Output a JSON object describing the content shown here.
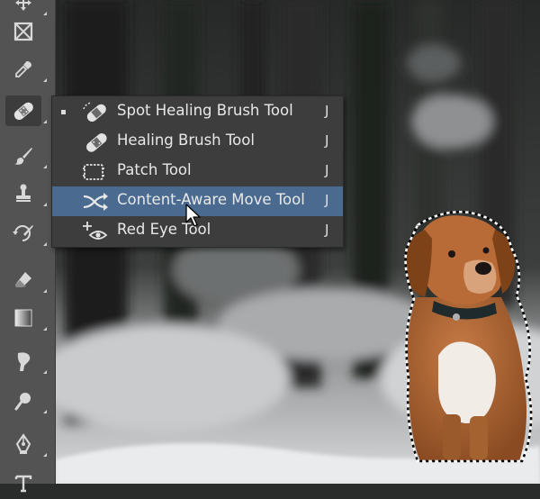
{
  "flyout": {
    "items": [
      {
        "label": "Spot Healing Brush Tool",
        "key": "J",
        "icon": "spot-healing-brush-icon"
      },
      {
        "label": "Healing Brush Tool",
        "key": "J",
        "icon": "healing-brush-icon"
      },
      {
        "label": "Patch Tool",
        "key": "J",
        "icon": "patch-icon"
      },
      {
        "label": "Content-Aware Move Tool",
        "key": "J",
        "icon": "content-aware-move-icon"
      },
      {
        "label": "Red Eye Tool",
        "key": "J",
        "icon": "red-eye-icon"
      }
    ],
    "selected_index": 0,
    "highlighted_index": 3
  },
  "toolbar": {
    "tools": [
      "move-icon",
      "frame-icon",
      "eyedropper-icon",
      "spot-healing-brush-icon",
      "brush-icon",
      "clone-stamp-icon",
      "history-brush-icon",
      "eraser-icon",
      "gradient-icon",
      "smudge-icon",
      "dodge-icon",
      "pen-icon",
      "type-icon"
    ]
  },
  "colors": {
    "toolbar_bg": "#535353",
    "menu_bg": "#3d3d3d",
    "highlight": "#4a6b8f",
    "text": "#e8e8e8"
  }
}
